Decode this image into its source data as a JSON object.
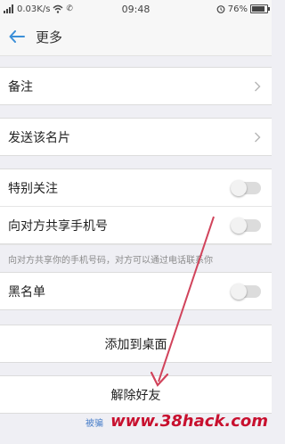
{
  "status_bar": {
    "network": "0.03K/s",
    "time": "09:48",
    "battery": "76%"
  },
  "nav": {
    "back_icon": "arrow-left-icon",
    "title": "更多"
  },
  "sections": {
    "remark": {
      "label": "备注"
    },
    "send_card": {
      "label": "发送该名片"
    },
    "special_follow": {
      "label": "特别关注"
    },
    "share_phone": {
      "label": "向对方共享手机号",
      "hint": "向对方共享你的手机号码，对方可以通过电话联系你"
    },
    "blacklist": {
      "label": "黑名单"
    },
    "add_desktop": {
      "label": "添加到桌面"
    },
    "delete_friend": {
      "label": "解除好友"
    }
  },
  "footer": {
    "link_text": "被骗",
    "watermark": "www.38hack.com"
  },
  "colors": {
    "accent": "#3b8fd8",
    "arrow": "#d1435b"
  }
}
